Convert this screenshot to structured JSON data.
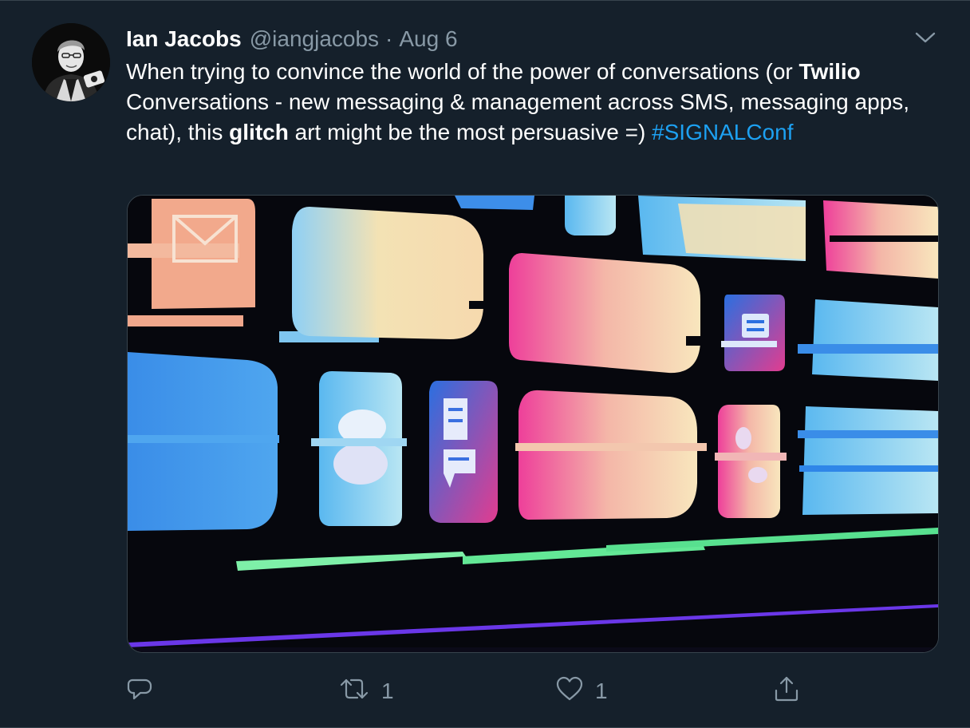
{
  "tweet": {
    "author_name": "Ian Jacobs",
    "handle": "@iangjacobs",
    "separator": "·",
    "date": "Aug 6",
    "text": {
      "p1": "When trying to convince the world of the power of conversations (or ",
      "b1": "Twilio",
      "p2": " Conversations - new messaging & management across SMS, messaging apps, chat), this ",
      "b2": "glitch",
      "p3": " art might be the most persuasive =) ",
      "hashtag": "#SIGNALConf"
    },
    "icons": {
      "more": "chevron-down-icon",
      "reply": "reply-icon",
      "retweet": "retweet-icon",
      "like": "heart-icon",
      "share": "share-icon"
    },
    "actions": {
      "reply_count": "",
      "retweet_count": "1",
      "like_count": "1"
    }
  },
  "colors": {
    "background": "#15202b",
    "secondary_text": "#8899a6",
    "link": "#1da1f2",
    "border": "#38444d"
  }
}
